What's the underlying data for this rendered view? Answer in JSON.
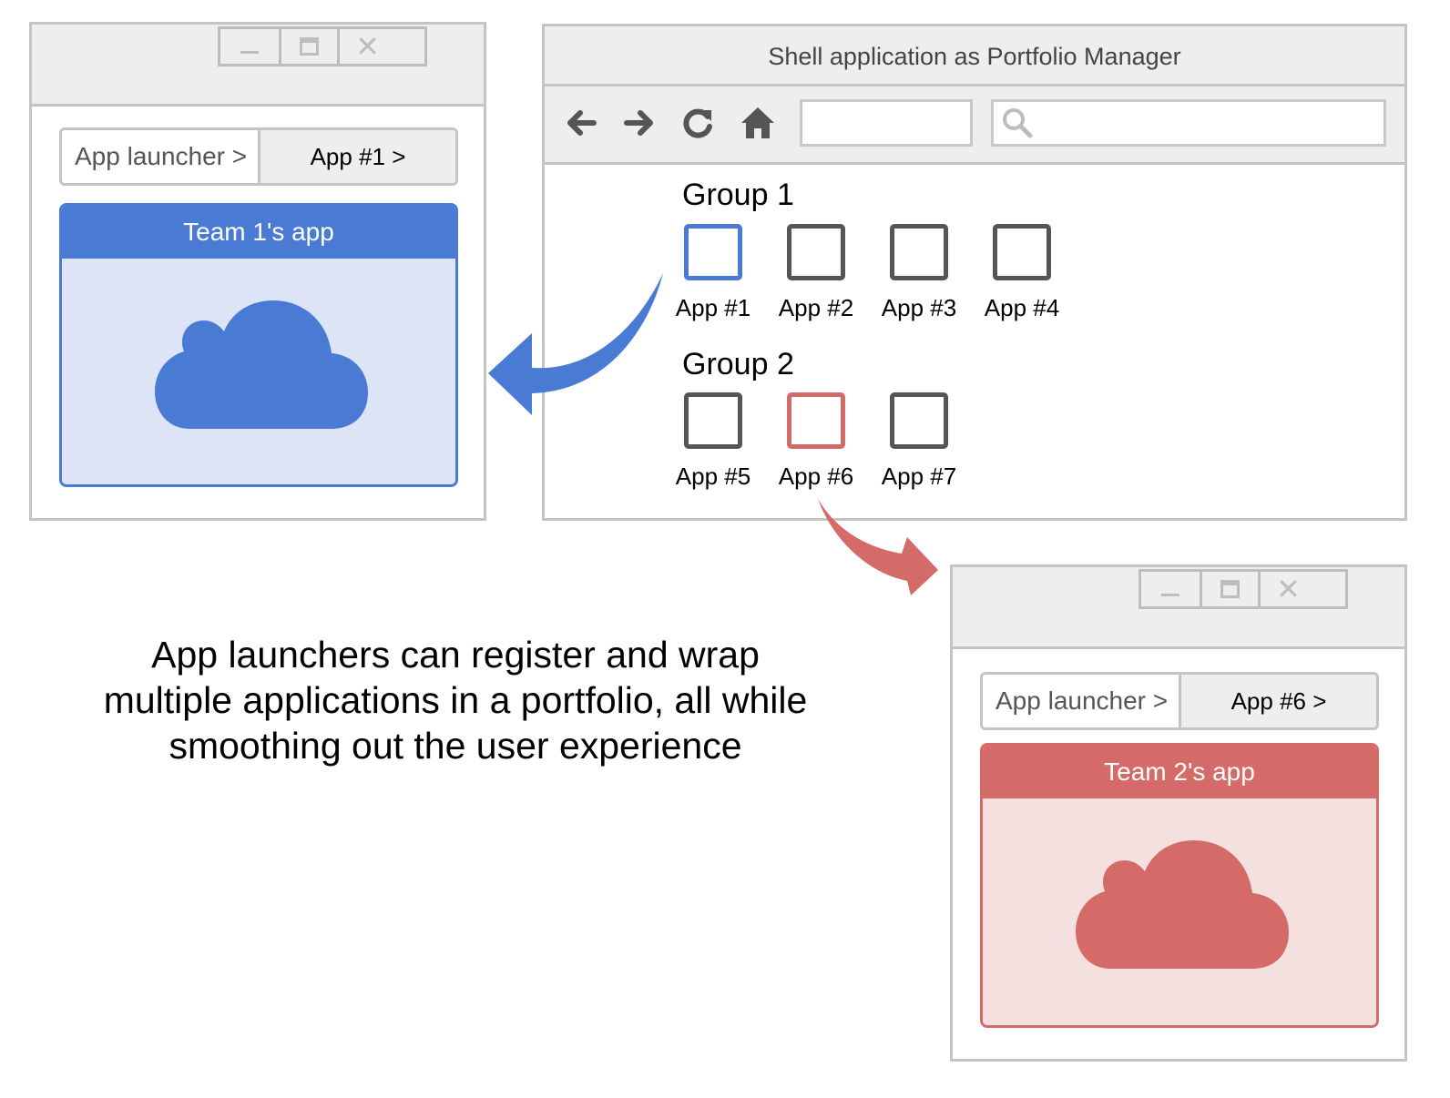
{
  "colors": {
    "team1": "#4a7bd4",
    "team1_light": "#dce4f5",
    "team2": "#d46b69",
    "team2_light": "#f5e0e0",
    "chrome": "#eeeeee",
    "border": "#c4c4c4",
    "tile": "#555555"
  },
  "shell": {
    "title": "Shell application as Portfolio Manager",
    "nav_icons": [
      "back-arrow-icon",
      "forward-arrow-icon",
      "reload-icon",
      "home-icon",
      "search-icon"
    ],
    "groups": [
      {
        "title": "Group 1",
        "apps": [
          {
            "label": "App #1",
            "state": "selected-team1"
          },
          {
            "label": "App #2",
            "state": "default"
          },
          {
            "label": "App #3",
            "state": "default"
          },
          {
            "label": "App #4",
            "state": "default"
          }
        ]
      },
      {
        "title": "Group 2",
        "apps": [
          {
            "label": "App #5",
            "state": "default"
          },
          {
            "label": "App #6",
            "state": "selected-team2"
          },
          {
            "label": "App #7",
            "state": "default"
          }
        ]
      }
    ]
  },
  "window_team1": {
    "window_controls": [
      "minimize-icon",
      "maximize-icon",
      "close-icon"
    ],
    "breadcrumb": {
      "launcher": "App launcher >",
      "app": "App #1 >"
    },
    "app_title": "Team 1's app",
    "icon": "cloud-icon"
  },
  "window_team2": {
    "window_controls": [
      "minimize-icon",
      "maximize-icon",
      "close-icon"
    ],
    "breadcrumb": {
      "launcher": "App launcher >",
      "app": "App #6 >"
    },
    "app_title": "Team 2's app",
    "icon": "cloud-icon"
  },
  "caption": {
    "lines": [
      "App launchers can register and wrap",
      "multiple applications in a portfolio, all while",
      "smoothing out the user experience"
    ]
  }
}
